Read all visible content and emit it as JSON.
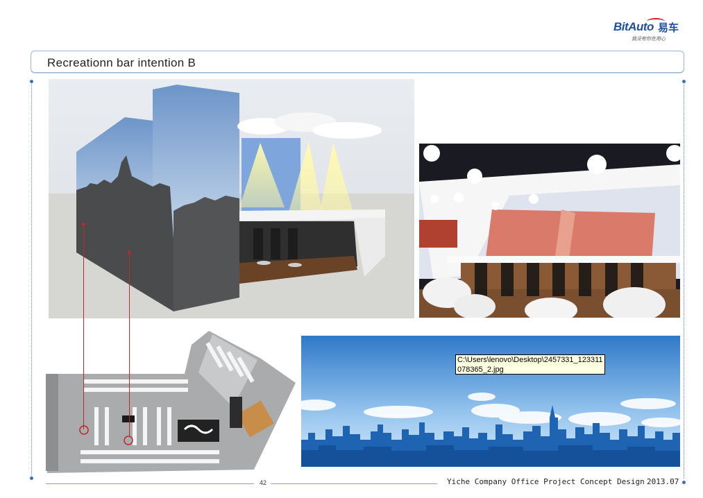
{
  "header": {
    "logo": {
      "brand": "BitAuto",
      "brand_cn": "易车",
      "tagline": "我没有你在用心"
    },
    "title": "Recreationn  bar intention B"
  },
  "images": {
    "render_3d": "bar-3d-rendering",
    "photo": "bar-interior-photo",
    "floor_plan": "office-floor-plan",
    "skyline": "city-skyline-graphic"
  },
  "tooltip": {
    "line1": "C:\\Users\\lenovo\\Desktop\\2457331_123311",
    "line2": "078365_2.jpg"
  },
  "footer": {
    "page_number": "42",
    "project": "Yiche Company Office Project Concept Design",
    "date": "2013.07"
  },
  "colors": {
    "accent_blue": "#1f4fa3",
    "accent_red": "#d0202a",
    "frame_line": "#9db3d6",
    "marker_red": "#c0262d"
  }
}
